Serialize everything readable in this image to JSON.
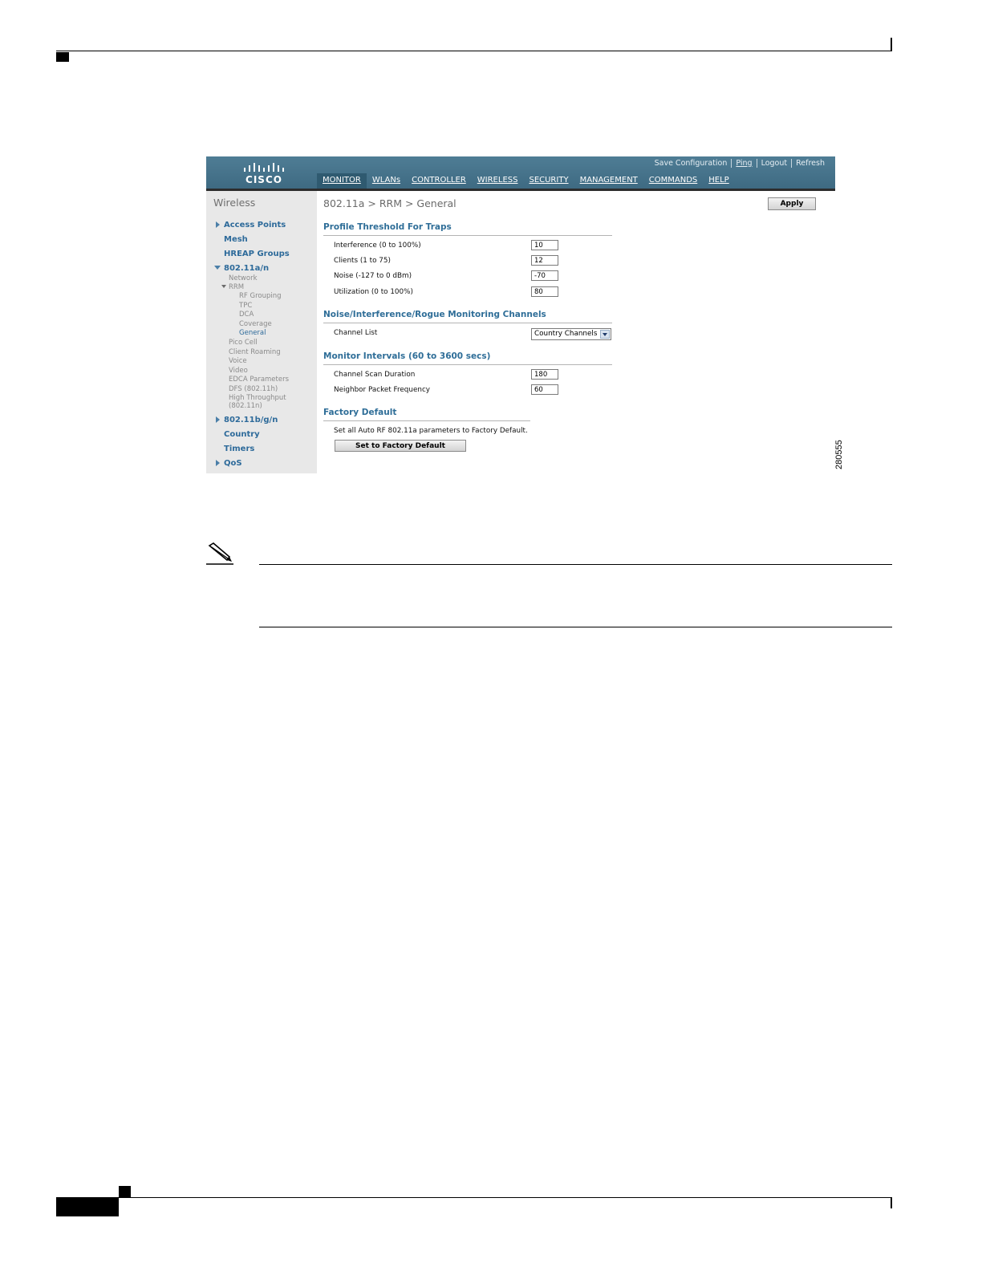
{
  "figure_id": "280555",
  "cisco_ui": {
    "logo_text": "cisco",
    "top_links": [
      "Save Configuration",
      "Ping",
      "Logout",
      "Refresh"
    ],
    "nav": [
      "MONITOR",
      "WLANs",
      "CONTROLLER",
      "WIRELESS",
      "SECURITY",
      "MANAGEMENT",
      "COMMANDS",
      "HELP"
    ],
    "active_nav": "WIRELESS",
    "sidebar": {
      "title": "Wireless",
      "access_points": "Access Points",
      "mesh": "Mesh",
      "hreap_groups": "HREAP Groups",
      "band_a": "802.11a/n",
      "network": "Network",
      "rrm": "RRM",
      "rf_grouping": "RF Grouping",
      "tpc": "TPC",
      "dca": "DCA",
      "coverage": "Coverage",
      "general": "General",
      "pico_cell": "Pico Cell",
      "client_roaming": "Client Roaming",
      "voice": "Voice",
      "video": "Video",
      "edca": "EDCA Parameters",
      "dfs": "DFS (802.11h)",
      "high_throughput_1": "High Throughput",
      "high_throughput_2": "(802.11n)",
      "band_bg": "802.11b/g/n",
      "country": "Country",
      "timers": "Timers",
      "qos": "QoS"
    },
    "content": {
      "breadcrumb": "802.11a > RRM > General",
      "apply_label": "Apply",
      "profile_title": "Profile Threshold For Traps",
      "interference_label": "Interference (0 to 100%)",
      "interference_value": "10",
      "clients_label": "Clients (1 to 75)",
      "clients_value": "12",
      "noise_label": "Noise (-127 to 0 dBm)",
      "noise_value": "-70",
      "utilization_label": "Utilization (0 to 100%)",
      "utilization_value": "80",
      "monitoring_title": "Noise/Interference/Rogue Monitoring Channels",
      "channel_list_label": "Channel List",
      "channel_list_value": "Country Channels",
      "intervals_title": "Monitor Intervals (60 to 3600 secs)",
      "scan_label": "Channel Scan Duration",
      "scan_value": "180",
      "neighbor_label": "Neighbor Packet Frequency",
      "neighbor_value": "60",
      "factory_title": "Factory Default",
      "factory_text": "Set all Auto RF 802.11a parameters to Factory Default.",
      "factory_button": "Set to Factory Default"
    }
  }
}
